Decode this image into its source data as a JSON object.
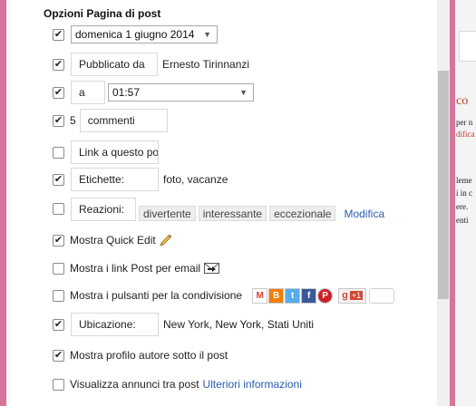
{
  "panel": {
    "title": "Opzioni Pagina di post",
    "date": {
      "value": "domenica 1 giugno 2014",
      "checked": "✔"
    },
    "published_by": {
      "label": "Pubblicato da",
      "author": "Ernesto Tirinnanzi",
      "checked": "✔"
    },
    "time": {
      "prefix": "a",
      "value": "01:57",
      "checked": "✔"
    },
    "comments": {
      "count": "5",
      "label": "commenti",
      "checked": "✔"
    },
    "link": {
      "label": "Link a questo pos",
      "checked": ""
    },
    "labels": {
      "label": "Etichette:",
      "value": "foto, vacanze",
      "checked": "✔"
    },
    "reactions": {
      "label": "Reazioni:",
      "chips": [
        "divertente",
        "interessante",
        "eccezionale"
      ],
      "edit_link": "Modifica",
      "checked": ""
    },
    "quick_edit": {
      "label": "Mostra Quick Edit",
      "checked": "✔",
      "icon": "pencil-icon"
    },
    "email_links": {
      "label": "Mostra i link Post per email",
      "checked": "",
      "icon": "email-icon"
    },
    "share_buttons": {
      "label": "Mostra i pulsanti per la condivisione",
      "checked": "",
      "buttons": [
        {
          "name": "gmail",
          "glyph": "M",
          "color": "#d44638"
        },
        {
          "name": "blogger",
          "glyph": "B",
          "color": "#f57d00"
        },
        {
          "name": "twitter",
          "glyph": "t",
          "color": "#55acee"
        },
        {
          "name": "facebook",
          "glyph": "f",
          "color": "#3b5998"
        },
        {
          "name": "pinterest",
          "glyph": "P",
          "color": "#cb2027"
        }
      ],
      "gplus": "+1"
    },
    "location": {
      "label": "Ubicazione:",
      "value": "New York, New York, Stati Uniti",
      "checked": "✔"
    },
    "author_profile": {
      "label": "Mostra profilo autore sotto il post",
      "checked": "✔"
    },
    "ads": {
      "label": "Visualizza annunci tra post",
      "link": "Ulteriori informazioni",
      "checked": ""
    }
  },
  "right_page": {
    "title_fragment": "co",
    "lines": [
      "per n",
      "difica",
      "leme",
      "i in c",
      "ere.",
      "enti"
    ]
  },
  "colors": {
    "frame": "#d5759c",
    "link": "#2a5db0"
  }
}
